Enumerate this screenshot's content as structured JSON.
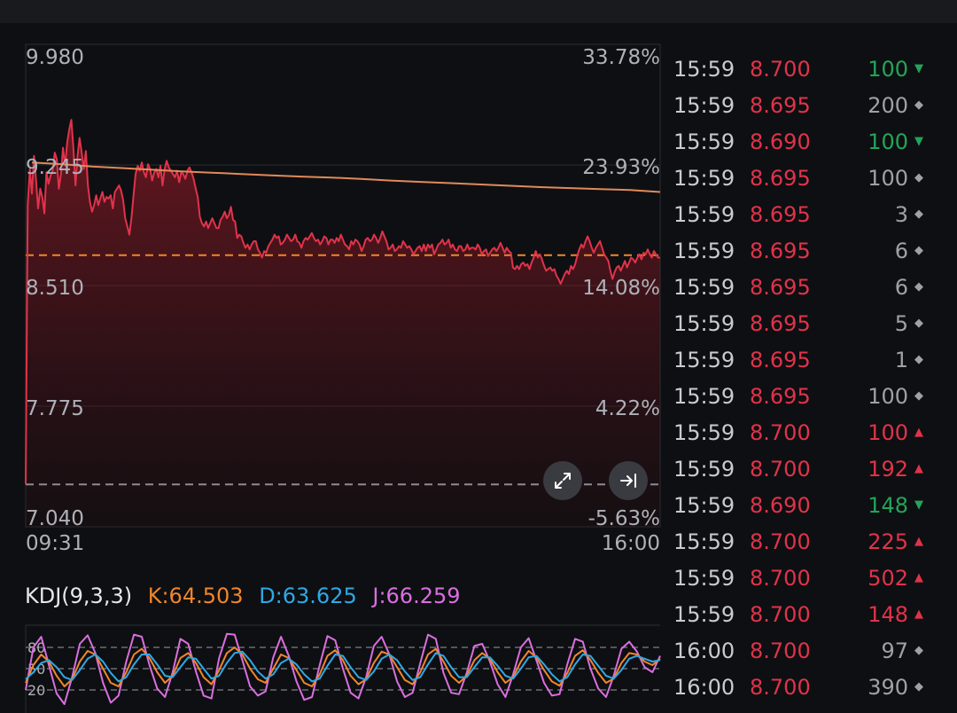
{
  "chart_data": [
    {
      "type": "line",
      "x_labels": [
        "09:31",
        "16:00"
      ],
      "ylim": [
        7.04,
        9.98
      ],
      "left_ticks": [
        "9.980",
        "9.245",
        "8.510",
        "7.775",
        "7.040"
      ],
      "right_ticks": [
        "33.78%",
        "23.93%",
        "14.08%",
        "4.22%",
        "-5.63%"
      ],
      "reference_price": 8.695,
      "lower_dashed_price": 7.298,
      "grid": true,
      "series": [
        {
          "role": "price",
          "color": "#e0334a",
          "values": [
            7.3,
            9.0,
            9.22,
            9.07,
            9.3,
            9.15,
            8.98,
            9.1,
            9.05,
            8.95,
            9.2,
            9.13,
            9.18,
            9.21,
            9.32,
            9.28,
            9.1,
            9.19,
            9.35,
            9.24,
            9.38,
            9.46,
            9.52,
            9.35,
            9.12,
            9.3,
            9.41,
            9.32,
            9.22,
            9.33,
            9.12,
            9.02,
            8.96,
            9.0,
            9.06,
            9.0,
            9.04,
            9.08,
            9.02,
            9.05,
            9.04,
            9.06,
            8.98,
            9.08,
            9.1,
            9.12,
            9.09,
            9.03,
            8.92,
            8.87,
            8.82,
            8.92,
            9.06,
            9.19,
            9.24,
            9.21,
            9.26,
            9.2,
            9.17,
            9.25,
            9.22,
            9.15,
            9.2,
            9.22,
            9.17,
            9.24,
            9.12,
            9.22,
            9.27,
            9.23,
            9.21,
            9.19,
            9.17,
            9.21,
            9.14,
            9.2,
            9.19,
            9.16,
            9.21,
            9.23,
            9.2,
            9.16,
            9.1,
            9.05,
            8.93,
            8.89,
            8.87,
            8.9,
            8.86,
            8.89,
            8.92,
            8.89,
            8.86,
            8.86,
            8.91,
            8.93,
            8.96,
            8.92,
            8.94,
            8.99,
            8.91,
            8.9,
            8.8,
            8.82,
            8.81,
            8.77,
            8.74,
            8.76,
            8.73,
            8.76,
            8.78,
            8.78,
            8.73,
            8.71,
            8.68,
            8.72,
            8.71,
            8.75,
            8.77,
            8.79,
            8.82,
            8.8,
            8.81,
            8.76,
            8.77,
            8.79,
            8.82,
            8.8,
            8.78,
            8.79,
            8.82,
            8.78,
            8.77,
            8.74,
            8.78,
            8.8,
            8.79,
            8.81,
            8.83,
            8.8,
            8.78,
            8.79,
            8.76,
            8.78,
            8.81,
            8.8,
            8.76,
            8.79,
            8.79,
            8.77,
            8.8,
            8.78,
            8.82,
            8.79,
            8.76,
            8.75,
            8.73,
            8.78,
            8.76,
            8.79,
            8.78,
            8.76,
            8.72,
            8.75,
            8.79,
            8.8,
            8.78,
            8.79,
            8.82,
            8.8,
            8.77,
            8.8,
            8.84,
            8.81,
            8.78,
            8.73,
            8.74,
            8.76,
            8.72,
            8.73,
            8.75,
            8.74,
            8.78,
            8.76,
            8.74,
            8.75,
            8.73,
            8.7,
            8.72,
            8.74,
            8.75,
            8.72,
            8.76,
            8.72,
            8.76,
            8.74,
            8.76,
            8.7,
            8.73,
            8.76,
            8.77,
            8.79,
            8.76,
            8.77,
            8.79,
            8.74,
            8.76,
            8.73,
            8.72,
            8.75,
            8.75,
            8.72,
            8.73,
            8.76,
            8.73,
            8.74,
            8.74,
            8.73,
            8.76,
            8.74,
            8.7,
            8.72,
            8.73,
            8.69,
            8.71,
            8.73,
            8.74,
            8.72,
            8.74,
            8.77,
            8.74,
            8.71,
            8.74,
            8.72,
            8.71,
            8.62,
            8.61,
            8.63,
            8.61,
            8.64,
            8.65,
            8.63,
            8.64,
            8.61,
            8.65,
            8.68,
            8.72,
            8.68,
            8.7,
            8.67,
            8.63,
            8.6,
            8.61,
            8.62,
            8.6,
            8.61,
            8.57,
            8.55,
            8.52,
            8.55,
            8.58,
            8.6,
            8.58,
            8.63,
            8.61,
            8.64,
            8.69,
            8.73,
            8.76,
            8.74,
            8.78,
            8.81,
            8.78,
            8.74,
            8.71,
            8.74,
            8.76,
            8.78,
            8.74,
            8.7,
            8.68,
            8.66,
            8.6,
            8.55,
            8.59,
            8.62,
            8.63,
            8.6,
            8.63,
            8.66,
            8.62,
            8.65,
            8.68,
            8.67,
            8.65,
            8.68,
            8.7,
            8.67,
            8.71,
            8.7,
            8.73,
            8.7,
            8.68,
            8.72,
            8.7,
            8.68,
            8.68
          ]
        },
        {
          "role": "average",
          "color": "#e08a5a",
          "values": [
            9.26,
            9.25,
            9.236,
            9.226,
            9.216,
            9.206,
            9.198,
            9.19,
            9.182,
            9.174,
            9.168,
            9.16,
            9.15,
            9.142,
            9.134,
            9.126,
            9.118,
            9.11,
            9.104,
            9.098,
            9.092,
            9.08
          ]
        }
      ]
    },
    {
      "type": "line",
      "title": "KDJ(9,3,3)",
      "ylim": [
        0,
        100
      ],
      "y_ticks": [
        "80",
        "50",
        "20"
      ],
      "grid": true,
      "series": [
        {
          "name": "K:64.503",
          "color": "#f0862b",
          "values": [
            30,
            55,
            70,
            60,
            40,
            25,
            35,
            60,
            75,
            70,
            50,
            30,
            25,
            45,
            70,
            78,
            65,
            45,
            30,
            40,
            65,
            72,
            58,
            38,
            28,
            48,
            72,
            80,
            70,
            50,
            35,
            30,
            50,
            70,
            65,
            48,
            30,
            25,
            42,
            68,
            76,
            62,
            40,
            28,
            35,
            58,
            74,
            70,
            52,
            34,
            28,
            45,
            70,
            78,
            60,
            40,
            30,
            40,
            62,
            72,
            64,
            45,
            30,
            38,
            60,
            75,
            66,
            48,
            32,
            26,
            44,
            68,
            76,
            62,
            44,
            30,
            36,
            58,
            72,
            70,
            60,
            55,
            64
          ]
        },
        {
          "name": "D:63.625",
          "color": "#2ea8e6",
          "values": [
            35,
            45,
            58,
            62,
            52,
            38,
            34,
            48,
            64,
            70,
            60,
            44,
            32,
            38,
            56,
            70,
            70,
            56,
            40,
            38,
            52,
            66,
            64,
            50,
            36,
            40,
            58,
            72,
            74,
            62,
            46,
            36,
            42,
            58,
            64,
            56,
            42,
            32,
            36,
            54,
            70,
            68,
            52,
            38,
            34,
            46,
            64,
            70,
            62,
            46,
            34,
            38,
            56,
            72,
            68,
            52,
            38,
            38,
            52,
            66,
            66,
            54,
            40,
            36,
            50,
            66,
            68,
            56,
            42,
            32,
            38,
            56,
            70,
            68,
            54,
            40,
            36,
            48,
            64,
            68,
            64,
            60,
            62
          ]
        },
        {
          "name": "J:66.259",
          "color": "#d96fe0",
          "values": [
            20,
            80,
            95,
            55,
            15,
            0,
            38,
            85,
            97,
            72,
            30,
            2,
            12,
            60,
            98,
            95,
            55,
            22,
            10,
            45,
            92,
            85,
            46,
            12,
            8,
            65,
            99,
            98,
            62,
            25,
            12,
            18,
            66,
            95,
            68,
            32,
            6,
            10,
            55,
            96,
            90,
            50,
            16,
            8,
            38,
            82,
            95,
            70,
            32,
            10,
            16,
            58,
            98,
            92,
            44,
            16,
            14,
            44,
            82,
            85,
            60,
            28,
            10,
            42,
            80,
            93,
            62,
            30,
            12,
            14,
            56,
            92,
            88,
            50,
            22,
            10,
            40,
            78,
            88,
            74,
            52,
            45,
            68
          ]
        }
      ]
    }
  ],
  "buttons": {
    "expand_icon": "expand-icon",
    "jump_end_icon": "jump-to-latest-icon"
  },
  "tick_list": [
    {
      "time": "15:59",
      "price": "8.700",
      "volume": "100",
      "dir": "down"
    },
    {
      "time": "15:59",
      "price": "8.695",
      "volume": "200",
      "dir": "neutral"
    },
    {
      "time": "15:59",
      "price": "8.690",
      "volume": "100",
      "dir": "down"
    },
    {
      "time": "15:59",
      "price": "8.695",
      "volume": "100",
      "dir": "neutral"
    },
    {
      "time": "15:59",
      "price": "8.695",
      "volume": "3",
      "dir": "neutral"
    },
    {
      "time": "15:59",
      "price": "8.695",
      "volume": "6",
      "dir": "neutral"
    },
    {
      "time": "15:59",
      "price": "8.695",
      "volume": "6",
      "dir": "neutral"
    },
    {
      "time": "15:59",
      "price": "8.695",
      "volume": "5",
      "dir": "neutral"
    },
    {
      "time": "15:59",
      "price": "8.695",
      "volume": "1",
      "dir": "neutral"
    },
    {
      "time": "15:59",
      "price": "8.695",
      "volume": "100",
      "dir": "neutral"
    },
    {
      "time": "15:59",
      "price": "8.700",
      "volume": "100",
      "dir": "up"
    },
    {
      "time": "15:59",
      "price": "8.700",
      "volume": "192",
      "dir": "up"
    },
    {
      "time": "15:59",
      "price": "8.690",
      "volume": "148",
      "dir": "down"
    },
    {
      "time": "15:59",
      "price": "8.700",
      "volume": "225",
      "dir": "up"
    },
    {
      "time": "15:59",
      "price": "8.700",
      "volume": "502",
      "dir": "up"
    },
    {
      "time": "15:59",
      "price": "8.700",
      "volume": "148",
      "dir": "up"
    },
    {
      "time": "16:00",
      "price": "8.700",
      "volume": "97",
      "dir": "neutral"
    },
    {
      "time": "16:00",
      "price": "8.700",
      "volume": "390",
      "dir": "neutral"
    }
  ],
  "colors": {
    "up": "#e0334a",
    "down": "#22a55a",
    "neutral": "#9ea1a8",
    "ref_line": "#f0862b"
  }
}
